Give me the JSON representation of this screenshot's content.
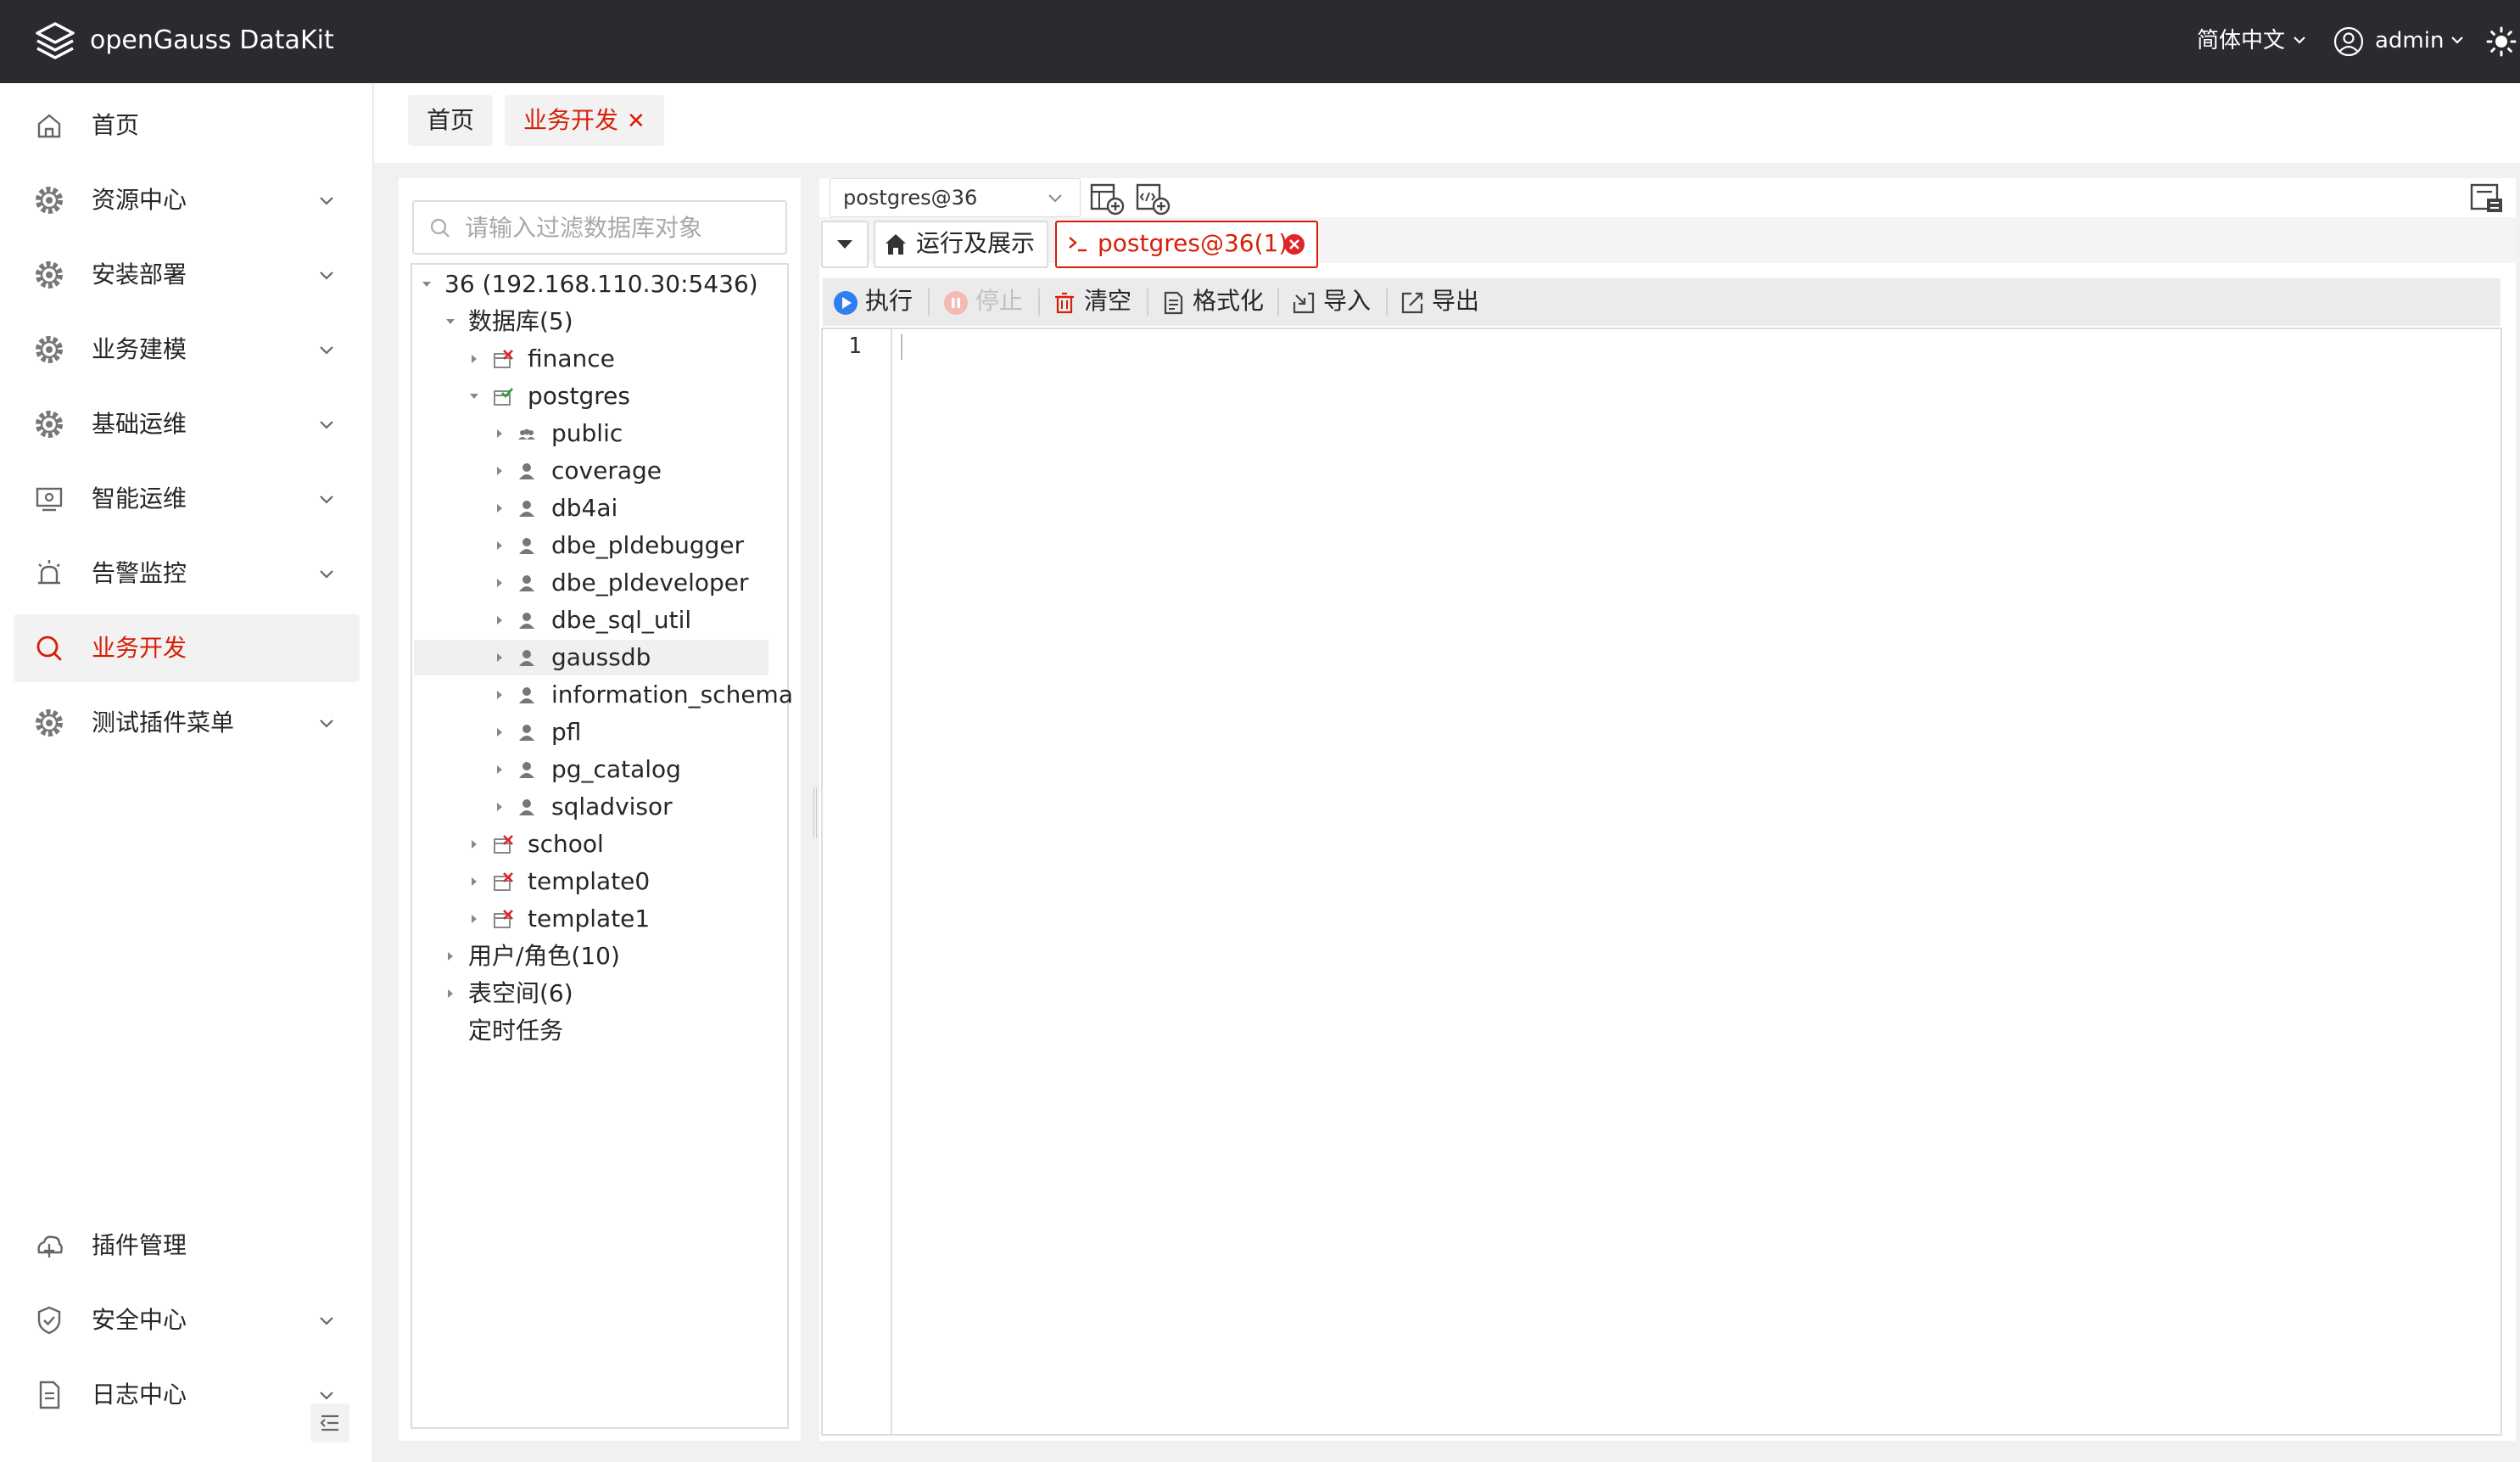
{
  "header": {
    "app_title": "openGauss DataKit",
    "language": "简体中文",
    "user": "admin"
  },
  "sidebar": {
    "items": [
      {
        "label": "首页",
        "icon": "home-icon",
        "expandable": false
      },
      {
        "label": "资源中心",
        "icon": "gear-icon",
        "expandable": true
      },
      {
        "label": "安装部署",
        "icon": "gear-icon",
        "expandable": true
      },
      {
        "label": "业务建模",
        "icon": "gear-icon",
        "expandable": true
      },
      {
        "label": "基础运维",
        "icon": "gear-icon",
        "expandable": true
      },
      {
        "label": "智能运维",
        "icon": "monitor-icon",
        "expandable": true
      },
      {
        "label": "告警监控",
        "icon": "alarm-icon",
        "expandable": true
      },
      {
        "label": "业务开发",
        "icon": "search-icon",
        "expandable": false,
        "active": true
      },
      {
        "label": "测试插件菜单",
        "icon": "gear-icon",
        "expandable": true
      }
    ],
    "bottom_items": [
      {
        "label": "插件管理",
        "icon": "plugin-icon",
        "expandable": false
      },
      {
        "label": "安全中心",
        "icon": "shield-icon",
        "expandable": true
      },
      {
        "label": "日志中心",
        "icon": "document-icon",
        "expandable": true
      }
    ]
  },
  "tabs": {
    "home": "首页",
    "dev": "业务开发",
    "close_glyph": "✕"
  },
  "tree": {
    "search_placeholder": "请输入过滤数据库对象",
    "root": "36 (192.168.110.30:5436)",
    "databases_label": "数据库(5)",
    "databases": [
      "finance",
      "postgres",
      "school",
      "template0",
      "template1"
    ],
    "schemas": [
      "public",
      "coverage",
      "db4ai",
      "dbe_pldebugger",
      "dbe_pldeveloper",
      "dbe_sql_util",
      "gaussdb",
      "information_schema",
      "pfl",
      "pg_catalog",
      "sqladvisor"
    ],
    "highlighted_schema": "gaussdb",
    "users_label": "用户/角色(10)",
    "tablespaces_label": "表空间(6)",
    "jobs_label": "定时任务"
  },
  "editor": {
    "connection": "postgres@36",
    "run_tab": "运行及展示",
    "sql_tab": "postgres@36(1)",
    "actions": {
      "execute": "执行",
      "stop": "停止",
      "clear": "清空",
      "format": "格式化",
      "import": "导入",
      "export": "导出"
    },
    "line_number": "1"
  },
  "colors": {
    "accent": "#d81e06",
    "header_bg": "#2b2b2f",
    "db_ok": "#2e9a3c",
    "db_err": "#e0242b",
    "run_blue": "#2f7ff0"
  }
}
